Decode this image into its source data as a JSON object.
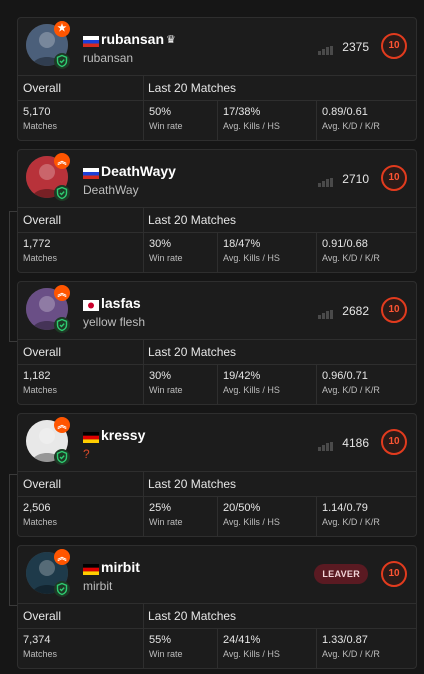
{
  "labels": {
    "overall": "Overall",
    "last20": "Last 20 Matches",
    "matches": "Matches",
    "win_rate": "Win rate",
    "avg_kills_hs": "Avg. Kills / HS",
    "avg_kd_kr": "Avg. K/D / K/R"
  },
  "players": [
    {
      "name": "rubansan",
      "subname": "rubansan",
      "flag": "ru",
      "top_badge": "star",
      "elo": "2375",
      "level": "10",
      "matches": "5,170",
      "win_rate": "50%",
      "kills_hs": "17/38%",
      "kd_kr": "0.89/0.61",
      "colors": {
        "avatar": "#4b5f7a"
      }
    },
    {
      "name": "DeathWayy",
      "subname": "DeathWay",
      "flag": "ru",
      "top_badge": "chevrons",
      "elo": "2710",
      "level": "10",
      "matches": "1,772",
      "win_rate": "30%",
      "kills_hs": "18/47%",
      "kd_kr": "0.91/0.68",
      "colors": {
        "avatar": "#b8323a"
      }
    },
    {
      "name": "lasfas",
      "subname": "yellow flesh",
      "flag": "jp",
      "top_badge": "chevrons",
      "elo": "2682",
      "level": "10",
      "matches": "1,182",
      "win_rate": "30%",
      "kills_hs": "19/42%",
      "kd_kr": "0.96/0.71",
      "colors": {
        "avatar": "#6a4f86"
      }
    },
    {
      "name": "kressy",
      "subname": "?",
      "flag": "de",
      "top_badge": "chevrons",
      "elo": "4186",
      "level": "10",
      "matches": "2,506",
      "win_rate": "25%",
      "kills_hs": "20/50%",
      "kd_kr": "1.14/0.79",
      "colors": {
        "avatar": "#e8e8e8"
      }
    },
    {
      "name": "mirbit",
      "subname": "mirbit",
      "flag": "de",
      "top_badge": "chevrons",
      "leaver": "LEAVER",
      "level": "10",
      "matches": "7,374",
      "win_rate": "55%",
      "kills_hs": "24/41%",
      "kd_kr": "1.33/0.87",
      "colors": {
        "avatar": "#1e3a4a"
      }
    }
  ],
  "colors": {
    "accent": "#ff5500",
    "level_ring": "#e23b1e",
    "shield": "#2ecc71",
    "leaver_bg": "#5a1a22"
  }
}
